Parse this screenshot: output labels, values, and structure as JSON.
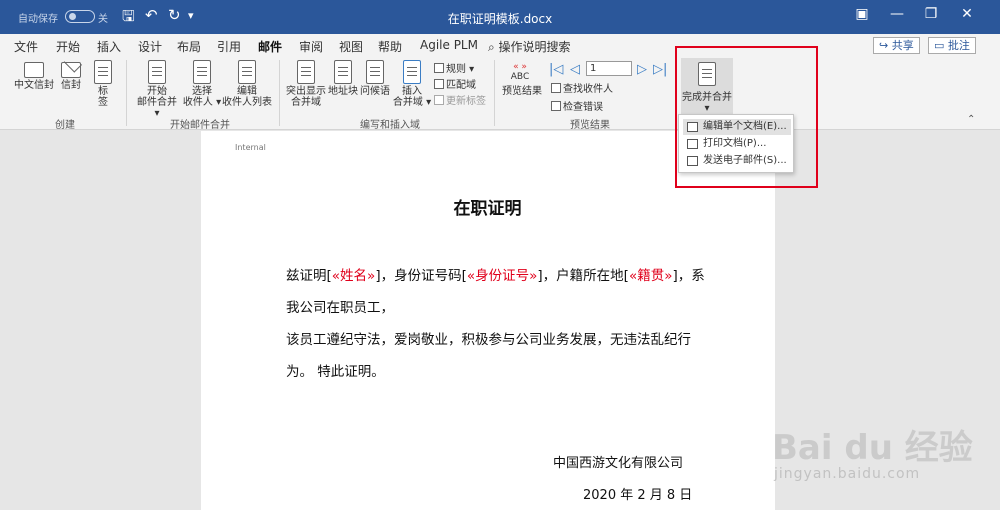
{
  "titlebar": {
    "autosave_label": "自动保存",
    "autosave_state": "关",
    "doc_title": "在职证明模板.docx",
    "qa_save_icon": "save-icon",
    "qa_undo_icon": "undo-icon",
    "qa_redo_icon": "redo-icon"
  },
  "tabs": [
    "文件",
    "开始",
    "插入",
    "设计",
    "布局",
    "引用",
    "邮件",
    "审阅",
    "视图",
    "帮助",
    "Agile PLM"
  ],
  "active_tab": "邮件",
  "tell_me": "操作说明搜索",
  "share_label": "共享",
  "comment_label": "批注",
  "ribbon": {
    "create": {
      "label": "创建",
      "btn1": "中文信封",
      "btn2": "信封",
      "btn3": "标签"
    },
    "start_merge": {
      "label": "开始邮件合并",
      "btn1_line1": "开始",
      "btn1_line2": "邮件合并 ▾",
      "btn2_line1": "选择",
      "btn2_line2": "收件人 ▾",
      "btn3_line1": "编辑",
      "btn3_line2": "收件人列表"
    },
    "write_insert": {
      "label": "编写和插入域",
      "btn1_line1": "突出显示",
      "btn1_line2": "合并域",
      "btn2": "地址块",
      "btn3": "问候语",
      "btn4_line1": "插入",
      "btn4_line2": "合并域 ▾",
      "rules": "规则 ▾",
      "match": "匹配域",
      "update": "更新标签"
    },
    "preview": {
      "label": "预览结果",
      "abc_top": "«   »",
      "abc_bottom": "ABC",
      "preview_btn": "预览结果",
      "record": "1",
      "find": "查找收件人",
      "check": "检查错误"
    },
    "finish": {
      "label": "完成并合并"
    }
  },
  "dropdown": {
    "item1": "编辑单个文档(E)...",
    "item2": "打印文档(P)...",
    "item3": "发送电子邮件(S)..."
  },
  "document": {
    "header_tag": "Internal",
    "heading": "在职证明",
    "p1_a": "兹证明[",
    "p1_f1": "«姓名»",
    "p1_b": "]，身份证号码[",
    "p1_f2": "«身份证号»",
    "p1_c": "]，户籍所在地[",
    "p1_f3": "«籍贯»",
    "p1_d": "]，系",
    "p2": "我公司在职员工，",
    "p3": "该员工遵纪守法，爱岗敬业，积极参与公司业务发展，无违法乱纪行",
    "p4": "为。  特此证明。",
    "company": "中国西游文化有限公司",
    "date": "2020 年 2 月 8 日"
  },
  "watermark": {
    "main": "Bai du 经验",
    "url": "jingyan.baidu.com"
  }
}
